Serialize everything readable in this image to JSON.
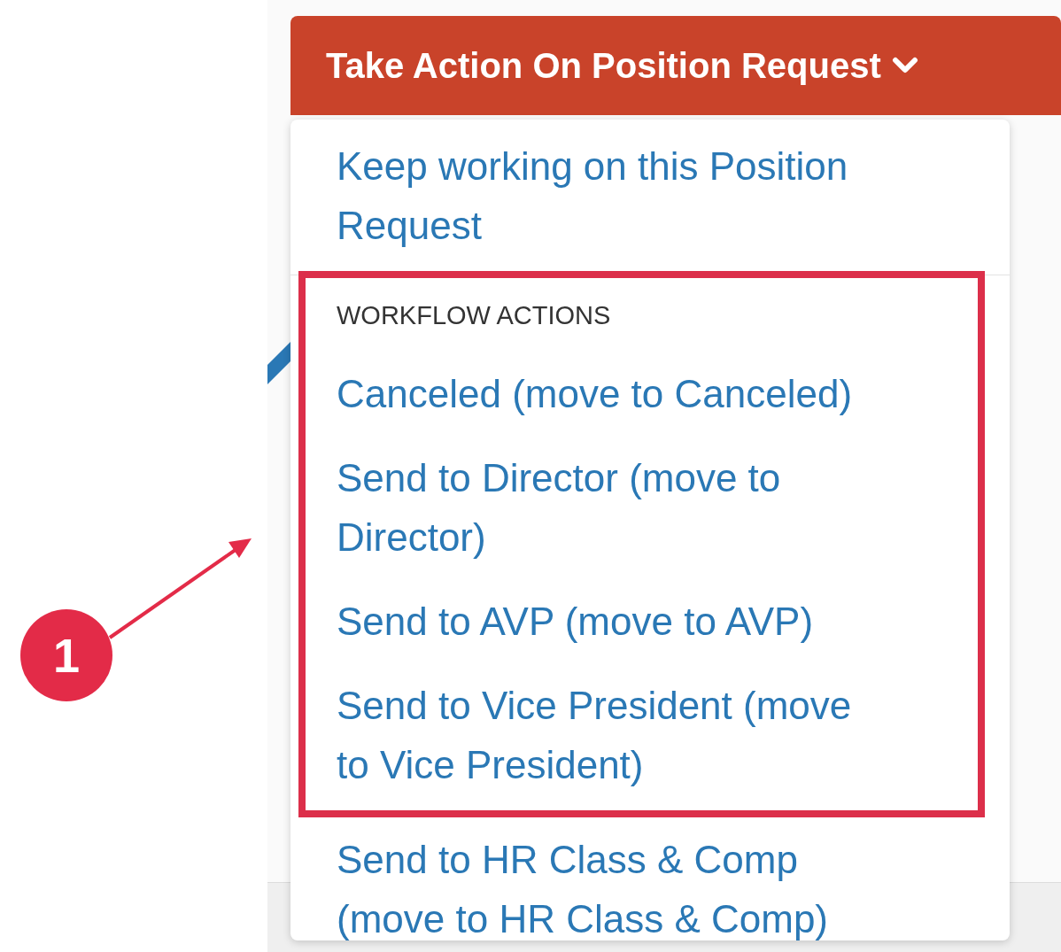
{
  "button": {
    "label": "Take Action On Position Request"
  },
  "menu": {
    "top_item": {
      "label": "Keep working on this Position Request"
    },
    "section": {
      "heading": "WORKFLOW ACTIONS",
      "heading_highlighted": true,
      "items": [
        {
          "label": "Canceled (move to Canceled)",
          "highlighted": true
        },
        {
          "label": "Send to Director (move to Director)",
          "highlighted": true
        },
        {
          "label": "Send to AVP (move to AVP)",
          "highlighted": true
        },
        {
          "label": "Send to Vice President (move to Vice President)",
          "highlighted": true
        },
        {
          "label": "Send to HR Class & Comp (move to HR Class & Comp)",
          "highlighted": false
        }
      ]
    }
  },
  "annotation": {
    "number": "1"
  }
}
